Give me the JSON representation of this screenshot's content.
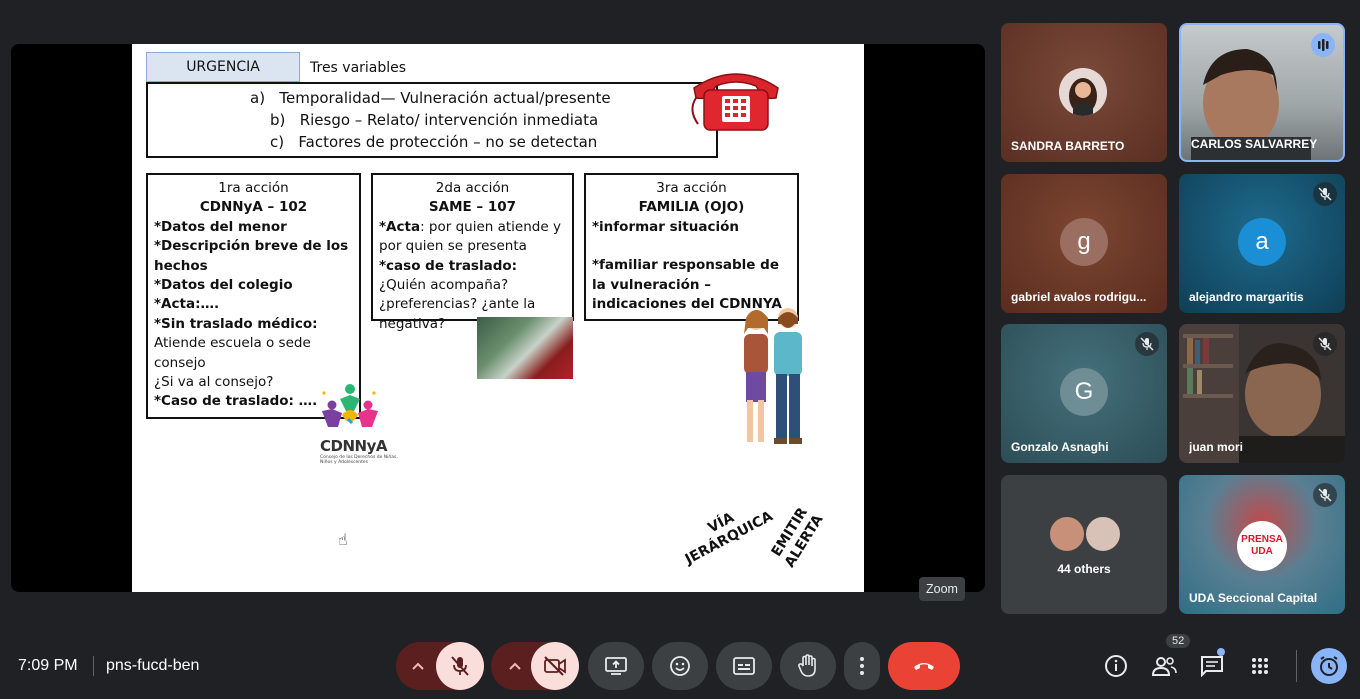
{
  "presentation": {
    "urgency_tab": "URGENCIA",
    "variables_title": "Tres variables",
    "variables": [
      {
        "letter": "a)",
        "text": "Temporalidad—  Vulneración actual/presente"
      },
      {
        "letter": "b)",
        "text": "Riesgo – Relato/ intervención inmediata"
      },
      {
        "letter": "c)",
        "text": "Factores de protección – no se detectan"
      }
    ],
    "action1": {
      "heading": "1ra acción",
      "subheading": "CDNNyA – 102",
      "line1": "*Datos del menor",
      "line2": "*Descripción breve de los hechos",
      "line3": "*Datos del colegio",
      "line4": "*Acta:….",
      "line5": "*Sin traslado médico:",
      "line6": "Atiende escuela o sede consejo",
      "line7": "¿Si va al consejo?",
      "line8": "*Caso de traslado: …."
    },
    "action2": {
      "heading": "2da acción",
      "subheading": "SAME – 107",
      "acta_label": "*Acta",
      "acta_text": ": por quien atiende y por quien se presenta",
      "traslado_label": "*caso de traslado:",
      "traslado_text": " ¿Quién acompaña? ¿preferencias? ¿ante la negativa?"
    },
    "action3": {
      "heading": "3ra acción",
      "subheading": "FAMILIA   (OJO)",
      "line1": "*informar situación",
      "line2": "*familiar responsable de la vulneración –  indicaciones del CDNNYA"
    },
    "logo_text": "CDNNyA",
    "logo_subtext": "Consejo de los Derechos de Niñas, Niños y Adolescentes",
    "via_label": "VÍA\nJERÁRQUICA",
    "emitir_label": "EMITIR\nALERTA"
  },
  "zoom_tooltip": "Zoom",
  "participants": [
    {
      "name": "SANDRA BARRETO",
      "muted": false,
      "bg": "#6d3a2c"
    },
    {
      "name": "CARLOS SALVARREY",
      "muted": false,
      "speaking": true,
      "bg": "#9aa3a6"
    },
    {
      "name": "gabriel avalos rodrigu...",
      "initial": "g",
      "muted": false,
      "bg": "#6a3a2a"
    },
    {
      "name": "alejandro margaritis",
      "initial": "a",
      "muted": true,
      "bg": "#15506e"
    },
    {
      "name": "Gonzalo Asnaghi",
      "initial": "G",
      "muted": true,
      "bg": "#355a64"
    },
    {
      "name": "juan mori",
      "muted": true,
      "bg": "#3a3532"
    },
    {
      "name": "44 others",
      "bg": "#3c4043"
    },
    {
      "name": "UDA Seccional Capital",
      "muted": true,
      "bg": "#2e6f86"
    }
  ],
  "logo_uda": "PRENSA\nUDA",
  "bottom_bar": {
    "time": "7:09 PM",
    "meeting_code": "pns-fucd-ben",
    "participant_count": "52"
  },
  "colors": {
    "end_call": "#ea4335",
    "muted_control": "#f9dedc",
    "muted_control_dark": "#5c1f1f",
    "active_accent": "#8ab4f8"
  }
}
